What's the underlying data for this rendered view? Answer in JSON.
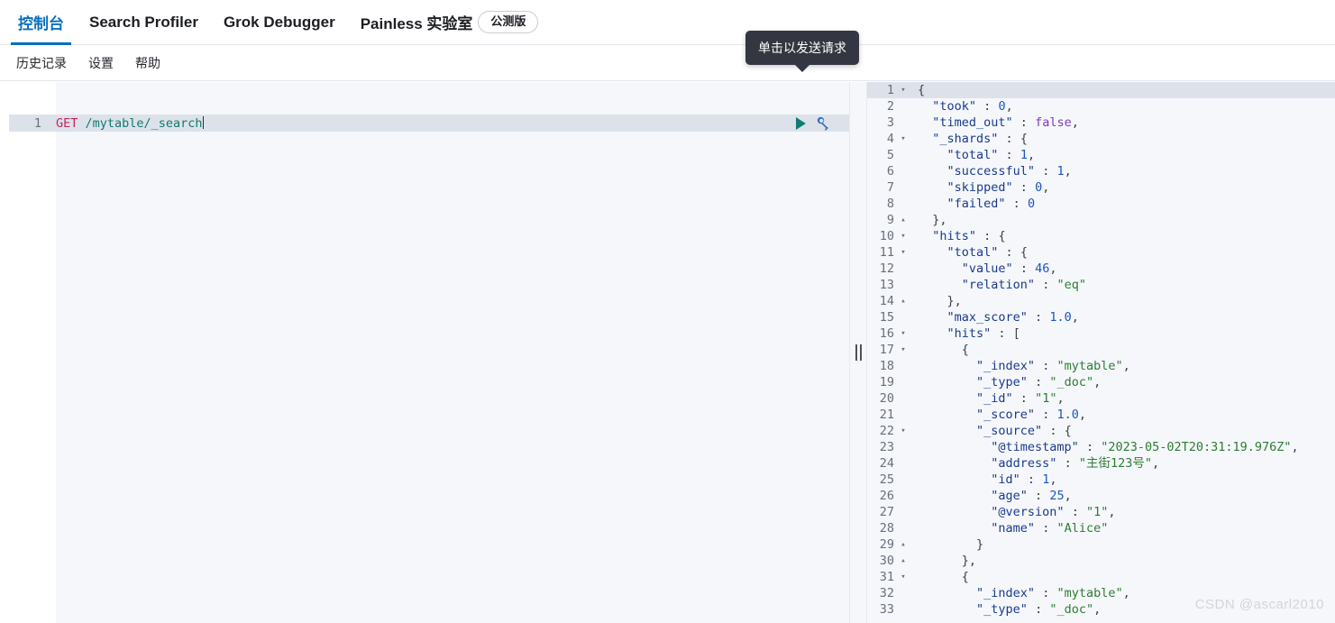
{
  "topnav": {
    "items": [
      {
        "label": "控制台",
        "active": true
      },
      {
        "label": "Search Profiler",
        "active": false
      },
      {
        "label": "Grok Debugger",
        "active": false
      },
      {
        "label": "Painless 实验室",
        "active": false
      }
    ],
    "badge": "公测版"
  },
  "subnav": {
    "items": [
      {
        "label": "历史记录"
      },
      {
        "label": "设置"
      },
      {
        "label": "帮助"
      }
    ]
  },
  "tooltip": {
    "text": "单击以发送请求"
  },
  "request": {
    "icons": {
      "play": "play-icon",
      "wrench": "wrench-icon"
    },
    "lines": [
      {
        "n": "1",
        "method": "GET",
        "url": " /mytable/_search"
      }
    ]
  },
  "response": {
    "lines": [
      {
        "n": "1",
        "fold": "▾",
        "indent": 0,
        "text": "{"
      },
      {
        "n": "2",
        "fold": "",
        "indent": 1,
        "key": "\"took\"",
        "sep": " : ",
        "val": "0",
        "type": "num",
        "tail": ","
      },
      {
        "n": "3",
        "fold": "",
        "indent": 1,
        "key": "\"timed_out\"",
        "sep": " : ",
        "val": "false",
        "type": "bool",
        "tail": ","
      },
      {
        "n": "4",
        "fold": "▾",
        "indent": 1,
        "key": "\"_shards\"",
        "sep": " : ",
        "val": "{",
        "type": "punct",
        "tail": ""
      },
      {
        "n": "5",
        "fold": "",
        "indent": 2,
        "key": "\"total\"",
        "sep": " : ",
        "val": "1",
        "type": "num",
        "tail": ","
      },
      {
        "n": "6",
        "fold": "",
        "indent": 2,
        "key": "\"successful\"",
        "sep": " : ",
        "val": "1",
        "type": "num",
        "tail": ","
      },
      {
        "n": "7",
        "fold": "",
        "indent": 2,
        "key": "\"skipped\"",
        "sep": " : ",
        "val": "0",
        "type": "num",
        "tail": ","
      },
      {
        "n": "8",
        "fold": "",
        "indent": 2,
        "key": "\"failed\"",
        "sep": " : ",
        "val": "0",
        "type": "num",
        "tail": ""
      },
      {
        "n": "9",
        "fold": "▴",
        "indent": 1,
        "text": "},"
      },
      {
        "n": "10",
        "fold": "▾",
        "indent": 1,
        "key": "\"hits\"",
        "sep": " : ",
        "val": "{",
        "type": "punct",
        "tail": ""
      },
      {
        "n": "11",
        "fold": "▾",
        "indent": 2,
        "key": "\"total\"",
        "sep": " : ",
        "val": "{",
        "type": "punct",
        "tail": ""
      },
      {
        "n": "12",
        "fold": "",
        "indent": 3,
        "key": "\"value\"",
        "sep": " : ",
        "val": "46",
        "type": "num",
        "tail": ","
      },
      {
        "n": "13",
        "fold": "",
        "indent": 3,
        "key": "\"relation\"",
        "sep": " : ",
        "val": "\"eq\"",
        "type": "str",
        "tail": ""
      },
      {
        "n": "14",
        "fold": "▴",
        "indent": 2,
        "text": "},"
      },
      {
        "n": "15",
        "fold": "",
        "indent": 2,
        "key": "\"max_score\"",
        "sep": " : ",
        "val": "1.0",
        "type": "num",
        "tail": ","
      },
      {
        "n": "16",
        "fold": "▾",
        "indent": 2,
        "key": "\"hits\"",
        "sep": " : ",
        "val": "[",
        "type": "punct",
        "tail": ""
      },
      {
        "n": "17",
        "fold": "▾",
        "indent": 3,
        "text": "{"
      },
      {
        "n": "18",
        "fold": "",
        "indent": 4,
        "key": "\"_index\"",
        "sep": " : ",
        "val": "\"mytable\"",
        "type": "str",
        "tail": ","
      },
      {
        "n": "19",
        "fold": "",
        "indent": 4,
        "key": "\"_type\"",
        "sep": " : ",
        "val": "\"_doc\"",
        "type": "str",
        "tail": ","
      },
      {
        "n": "20",
        "fold": "",
        "indent": 4,
        "key": "\"_id\"",
        "sep": " : ",
        "val": "\"1\"",
        "type": "str",
        "tail": ","
      },
      {
        "n": "21",
        "fold": "",
        "indent": 4,
        "key": "\"_score\"",
        "sep": " : ",
        "val": "1.0",
        "type": "num",
        "tail": ","
      },
      {
        "n": "22",
        "fold": "▾",
        "indent": 4,
        "key": "\"_source\"",
        "sep": " : ",
        "val": "{",
        "type": "punct",
        "tail": ""
      },
      {
        "n": "23",
        "fold": "",
        "indent": 5,
        "key": "\"@timestamp\"",
        "sep": " : ",
        "val": "\"2023-05-02T20:31:19.976Z\"",
        "type": "str",
        "tail": ","
      },
      {
        "n": "24",
        "fold": "",
        "indent": 5,
        "key": "\"address\"",
        "sep": " : ",
        "val": "\"主街123号\"",
        "type": "str",
        "tail": ","
      },
      {
        "n": "25",
        "fold": "",
        "indent": 5,
        "key": "\"id\"",
        "sep": " : ",
        "val": "1",
        "type": "num",
        "tail": ","
      },
      {
        "n": "26",
        "fold": "",
        "indent": 5,
        "key": "\"age\"",
        "sep": " : ",
        "val": "25",
        "type": "num",
        "tail": ","
      },
      {
        "n": "27",
        "fold": "",
        "indent": 5,
        "key": "\"@version\"",
        "sep": " : ",
        "val": "\"1\"",
        "type": "str",
        "tail": ","
      },
      {
        "n": "28",
        "fold": "",
        "indent": 5,
        "key": "\"name\"",
        "sep": " : ",
        "val": "\"Alice\"",
        "type": "str",
        "tail": ""
      },
      {
        "n": "29",
        "fold": "▴",
        "indent": 4,
        "text": "}"
      },
      {
        "n": "30",
        "fold": "▴",
        "indent": 3,
        "text": "},"
      },
      {
        "n": "31",
        "fold": "▾",
        "indent": 3,
        "text": "{"
      },
      {
        "n": "32",
        "fold": "",
        "indent": 4,
        "key": "\"_index\"",
        "sep": " : ",
        "val": "\"mytable\"",
        "type": "str",
        "tail": ","
      },
      {
        "n": "33",
        "fold": "",
        "indent": 4,
        "key": "\"_type\"",
        "sep": " : ",
        "val": "\"_doc\"",
        "type": "str",
        "tail": ","
      }
    ]
  },
  "watermark": {
    "text": "CSDN @ascarl2010"
  },
  "colors": {
    "accent": "#0a6ebd",
    "tooltip_bg": "#343741",
    "play": "#107d72",
    "wrench": "#2f6fc9",
    "method": "#c0255f",
    "url": "#0e7b6e",
    "json_key": "#1a3b8c",
    "json_string": "#2e7d32",
    "json_number": "#1a56c4",
    "json_bool": "#7d3ac1",
    "active_line": "#dde2ea",
    "editor_bg": "#f5f7fa"
  }
}
